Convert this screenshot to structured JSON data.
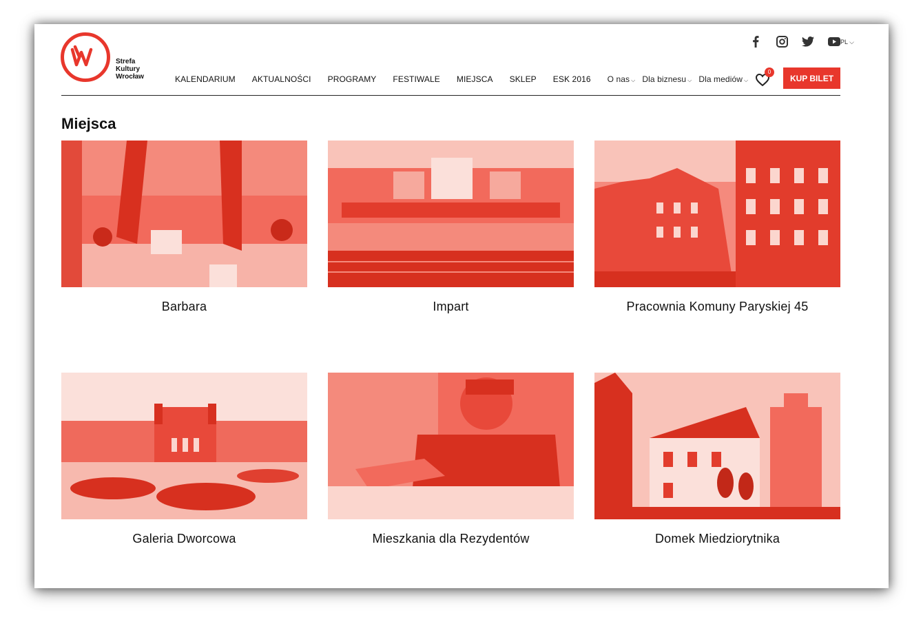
{
  "brand": {
    "name_lines": [
      "Strefa",
      "Kultury",
      "Wrocław"
    ],
    "color": "#e8372c"
  },
  "social": [
    {
      "icon": "facebook-icon"
    },
    {
      "icon": "instagram-icon"
    },
    {
      "icon": "twitter-icon"
    },
    {
      "icon": "youtube-icon"
    }
  ],
  "language": {
    "selected": "PL"
  },
  "nav": {
    "items": [
      "KALENDARIUM",
      "AKTUALNOŚCI",
      "PROGRAMY",
      "FESTIWALE",
      "MIEJSCA",
      "SKLEP",
      "ESK 2016"
    ],
    "dropdowns": [
      "O nas",
      "Dla biznesu",
      "Dla mediów"
    ]
  },
  "wishlist": {
    "count": "0"
  },
  "buy_button": {
    "label": "KUP BILET"
  },
  "page": {
    "title": "Miejsca"
  },
  "places": [
    {
      "name": "Barbara"
    },
    {
      "name": "Impart"
    },
    {
      "name": "Pracownia Komuny Paryskiej 45"
    },
    {
      "name": "Galeria Dworcowa"
    },
    {
      "name": "Mieszkania dla Rezydentów"
    },
    {
      "name": "Domek Miedziorytnika"
    }
  ]
}
